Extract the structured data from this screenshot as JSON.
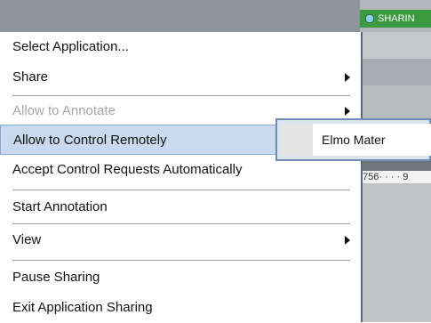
{
  "window": {
    "sharing_tab_label": "SHARIN",
    "ruler_text": "756· · · · 9"
  },
  "menu": {
    "items": [
      {
        "label": "Select Application...",
        "state": "normal",
        "submenu": false
      },
      {
        "label": "Share",
        "state": "normal",
        "submenu": true
      },
      {
        "label": "Allow to Annotate",
        "state": "disabled",
        "submenu": true
      },
      {
        "label": "Allow to Control Remotely",
        "state": "highlighted",
        "submenu": false
      },
      {
        "label": "Accept Control Requests Automatically",
        "state": "normal",
        "submenu": false
      },
      {
        "label": "Start Annotation",
        "state": "normal",
        "submenu": false
      },
      {
        "label": "View",
        "state": "normal",
        "submenu": true
      },
      {
        "label": "Pause Sharing",
        "state": "normal",
        "submenu": false
      },
      {
        "label": "Exit Application Sharing",
        "state": "normal",
        "submenu": false
      }
    ]
  },
  "submenu": {
    "items": [
      {
        "label": "Elmo Mater"
      }
    ]
  },
  "colors": {
    "highlight": "#c9d9ee",
    "sharing_tab": "#3a9a3f",
    "disabled_text": "#a7a7a7"
  }
}
